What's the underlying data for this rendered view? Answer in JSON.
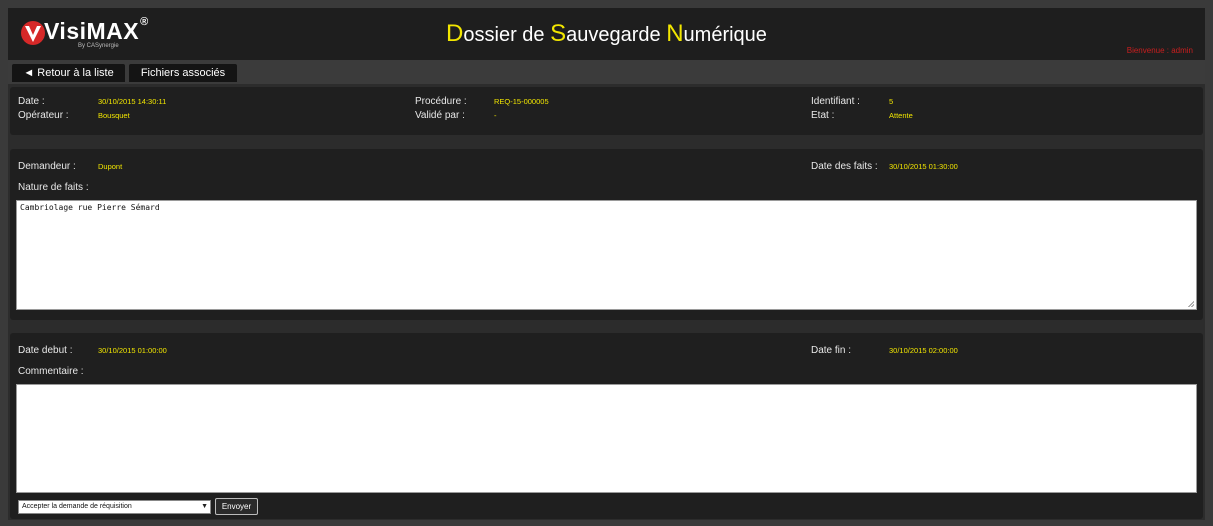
{
  "header": {
    "logo_text": "VisiMAX",
    "logo_reg": "®",
    "logo_sub": "By CASynergie",
    "title_parts": [
      {
        "cap": "D",
        "rest": "ossier de "
      },
      {
        "cap": "S",
        "rest": "auvegarde "
      },
      {
        "cap": "N",
        "rest": "umérique"
      }
    ],
    "welcome": "Bienvenue : admin"
  },
  "tabs": {
    "back": "◄ Retour à la liste",
    "files": "Fichiers associés"
  },
  "info": {
    "date_label": "Date :",
    "date_value": "30/10/2015 14:30:11",
    "operator_label": "Opérateur :",
    "operator_value": "Bousquet",
    "procedure_label": "Procédure :",
    "procedure_value": "REQ-15-000005",
    "validated_label": "Validé par :",
    "validated_value": "-",
    "id_label": "Identifiant :",
    "id_value": "5",
    "state_label": "Etat :",
    "state_value": "Attente"
  },
  "request": {
    "requester_label": "Demandeur :",
    "requester_value": "Dupont",
    "facts_date_label": "Date des faits :",
    "facts_date_value": "30/10/2015 01:30:00",
    "nature_label": "Nature de faits :",
    "nature_value": "Cambriolage rue Pierre Sémard"
  },
  "period": {
    "start_label": "Date debut :",
    "start_value": "30/10/2015 01:00:00",
    "end_label": "Date fin :",
    "end_value": "30/10/2015 02:00:00",
    "comment_label": "Commentaire :",
    "comment_value": ""
  },
  "actions": {
    "select_value": "Accepter la demande de réquisition",
    "send_label": "Envoyer"
  },
  "colors": {
    "accent": "#f2e600",
    "welcome": "#c81e1e"
  }
}
